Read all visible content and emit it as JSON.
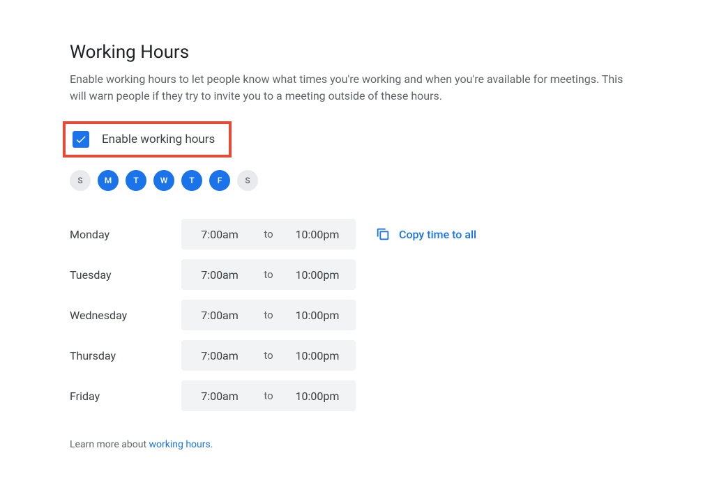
{
  "title": "Working Hours",
  "description": "Enable working hours to let people know what times you're working and when you're available for meetings. This will warn people if they try to invite you to a meeting outside of these hours.",
  "enable": {
    "label": "Enable working hours",
    "checked": true
  },
  "days": {
    "chips": [
      {
        "short": "S",
        "selected": false
      },
      {
        "short": "M",
        "selected": true
      },
      {
        "short": "T",
        "selected": true
      },
      {
        "short": "W",
        "selected": true
      },
      {
        "short": "T",
        "selected": true
      },
      {
        "short": "F",
        "selected": true
      },
      {
        "short": "S",
        "selected": false
      }
    ]
  },
  "to_label": "to",
  "schedule": [
    {
      "day": "Monday",
      "start": "7:00am",
      "end": "10:00pm"
    },
    {
      "day": "Tuesday",
      "start": "7:00am",
      "end": "10:00pm"
    },
    {
      "day": "Wednesday",
      "start": "7:00am",
      "end": "10:00pm"
    },
    {
      "day": "Thursday",
      "start": "7:00am",
      "end": "10:00pm"
    },
    {
      "day": "Friday",
      "start": "7:00am",
      "end": "10:00pm"
    }
  ],
  "copy_all": "Copy time to all",
  "learn_more": {
    "prefix": "Learn more about ",
    "link_text": "working hours",
    "suffix": "."
  }
}
